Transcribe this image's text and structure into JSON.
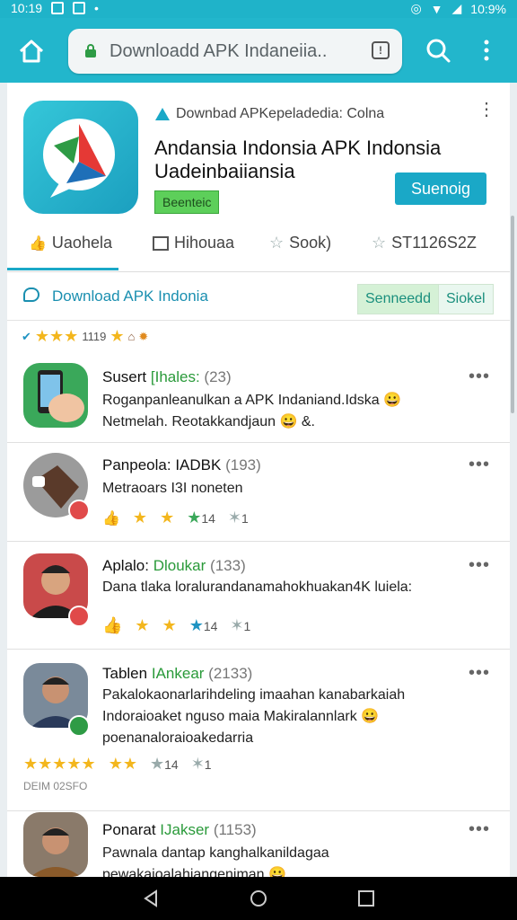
{
  "status_bar": {
    "time": "10:19",
    "battery": "10:9%"
  },
  "browser": {
    "url": "Downloadd APK Indaneiia..",
    "reader_icon": "!"
  },
  "app": {
    "developer": "Downbad APKepeladedia: Colna",
    "title": "Andansia Indonsia APK Indonsia Uadeinbaiiansia",
    "badge": "Beenteic",
    "install_label": "Suenoig"
  },
  "tabs": [
    {
      "label": "Uaohela"
    },
    {
      "label": "Hihouaa"
    },
    {
      "label": "Sook)"
    },
    {
      "label": "ST1126S2Z"
    }
  ],
  "section": {
    "label": "Download APK Indonia",
    "seg_on": "Senneedd",
    "seg_off": "Siokel"
  },
  "rating_summary": {
    "text": "1119"
  },
  "reviews": [
    {
      "name": "Susert",
      "tag": "[Ihales:",
      "count": "(23)",
      "text": "Roganpanleanulkan a APK Indaniand.Idska 😀 Netmelah. Reotakkandjaun 😀 &."
    },
    {
      "name": "Panpeola:",
      "tag": "IADBK",
      "count": "(193)",
      "text": "Metraoars I3I noneten",
      "vote_a": "14",
      "vote_b": "1"
    },
    {
      "name": "Aplalo:",
      "tag": "Dloukar",
      "count": "(133)",
      "text": "Dana tlaka loralurandanamahokhuakan4K luiela:",
      "vote_a": "14",
      "vote_b": "1"
    },
    {
      "name": "Tablen",
      "tag": "IAnkear",
      "count": "(2133)",
      "text": "Pakalokaonarlarihdeling imaahan kanabarkaiah Indoraioaket nguso maia Makiralannlark 😀 poenanaloraioakedarria",
      "vote_a": "14",
      "vote_b": "1",
      "date": "DEIM 02SFO"
    },
    {
      "name": "Ponarat",
      "tag": "IJakser",
      "count": "(1153)",
      "text": "Pawnala dantap kanghalkanildagaa pewakaioalahjangenjman 😀 ."
    }
  ],
  "colors": {
    "accent": "#22b6cc",
    "green": "#3ba85a",
    "star": "#f3b61d"
  }
}
